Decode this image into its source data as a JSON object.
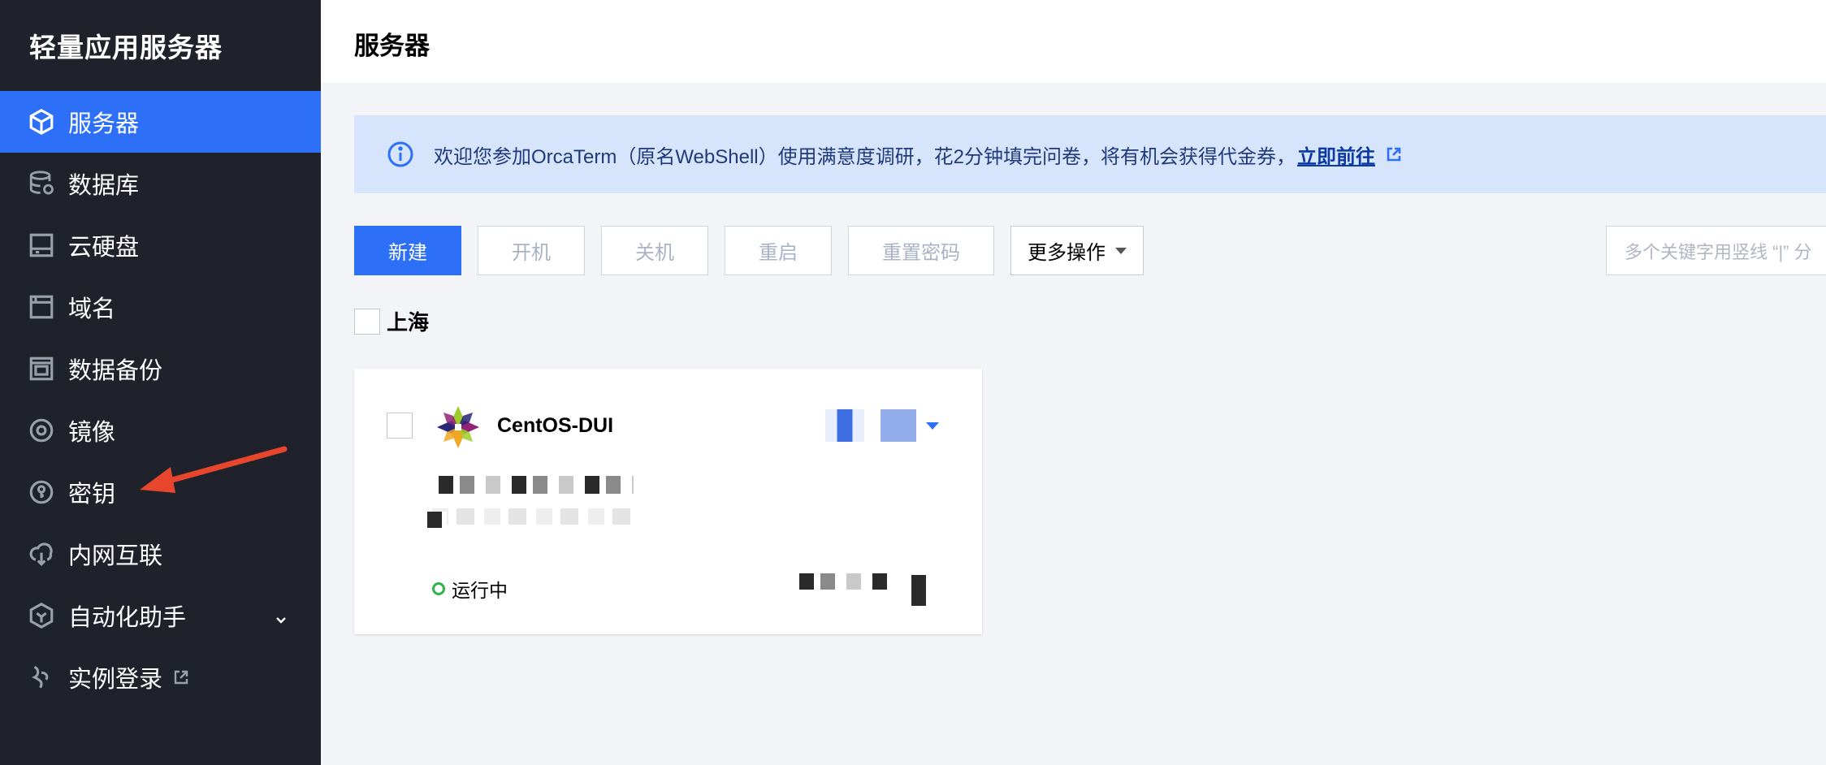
{
  "app": {
    "brand": "轻量应用服务器"
  },
  "sidebar": {
    "items": [
      {
        "label": "服务器",
        "icon": "server-cube-icon",
        "active": true
      },
      {
        "label": "数据库",
        "icon": "database-icon",
        "active": false
      },
      {
        "label": "云硬盘",
        "icon": "cloud-disk-icon",
        "active": false
      },
      {
        "label": "域名",
        "icon": "domain-icon",
        "active": false
      },
      {
        "label": "数据备份",
        "icon": "backup-icon",
        "active": false
      },
      {
        "label": "镜像",
        "icon": "image-icon",
        "active": false
      },
      {
        "label": "密钥",
        "icon": "key-icon",
        "active": false
      },
      {
        "label": "内网互联",
        "icon": "network-icon",
        "active": false
      },
      {
        "label": "自动化助手",
        "icon": "automation-icon",
        "active": false,
        "expandable": true
      },
      {
        "label": "实例登录",
        "icon": "login-icon",
        "active": false,
        "external": true
      }
    ]
  },
  "header": {
    "title": "服务器"
  },
  "notice": {
    "text": "欢迎您参加OrcaTerm（原名WebShell）使用满意度调研，花2分钟填完问卷，将有机会获得代金券，",
    "link": "立即前往"
  },
  "toolbar": {
    "create": "新建",
    "start": "开机",
    "stop": "关机",
    "restart": "重启",
    "reset_password": "重置密码",
    "more": "更多操作",
    "search_placeholder": "多个关键字用竖线 “|” 分"
  },
  "region": {
    "label": "上海"
  },
  "instance": {
    "name": "CentOS-DUI",
    "status": "运行中"
  },
  "colors": {
    "sidebar_bg": "#1f222b",
    "accent": "#2d6ff6",
    "notice_bg": "#d7e5fc",
    "running": "#2fb44a",
    "annotation": "#e8452d"
  }
}
